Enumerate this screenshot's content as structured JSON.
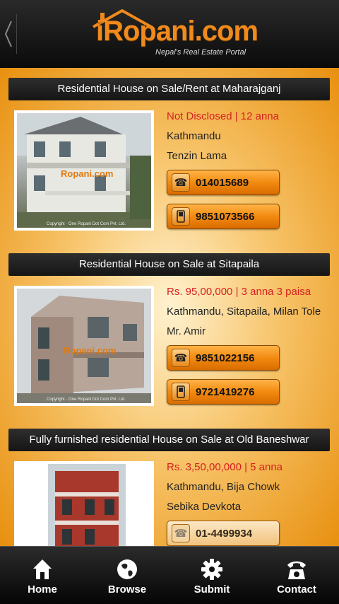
{
  "header": {
    "logo_main": "iRopani.com",
    "logo_tagline": "Nepal's Real Estate Portal",
    "back_icon": "chevron-left-icon"
  },
  "listings": [
    {
      "title": "Residential House on Sale/Rent at Maharajganj",
      "price": "Not Disclosed |  12 anna",
      "location": "Kathmandu",
      "agent": "Tenzin  Lama",
      "phone": "014015689",
      "mobile": "9851073566",
      "watermark": "Ropani.com",
      "copyright": "Copyright   ·   One Ropani Dot Com Pvt. Ltd."
    },
    {
      "title": "Residential House on Sale at Sitapaila",
      "price": "Rs. 95,00,000 |  3 anna 3 paisa",
      "location": "Kathmandu, Sitapaila, Milan Tole",
      "agent": "Mr.  Amir",
      "phone": "9851022156",
      "mobile": "9721419276",
      "watermark": "Ropani.com",
      "copyright": "Copyright   ·   One Ropani Dot Com Pvt. Ltd."
    },
    {
      "title": "Fully furnished residential House on Sale at Old Baneshwar",
      "price": "Rs. 3,50,00,000 |  5 anna",
      "location": "Kathmandu, Bija Chowk",
      "agent": "Sebika  Devkota",
      "phone": "01-4499934"
    }
  ],
  "tabs": [
    {
      "label": "Home",
      "icon": "home-icon"
    },
    {
      "label": "Browse",
      "icon": "globe-icon"
    },
    {
      "label": "Submit",
      "icon": "gear-icon"
    },
    {
      "label": "Contact",
      "icon": "telephone-icon"
    }
  ],
  "colors": {
    "accent": "#f08a1c",
    "price": "#d82020",
    "title_bar": "#1f1f1f"
  }
}
